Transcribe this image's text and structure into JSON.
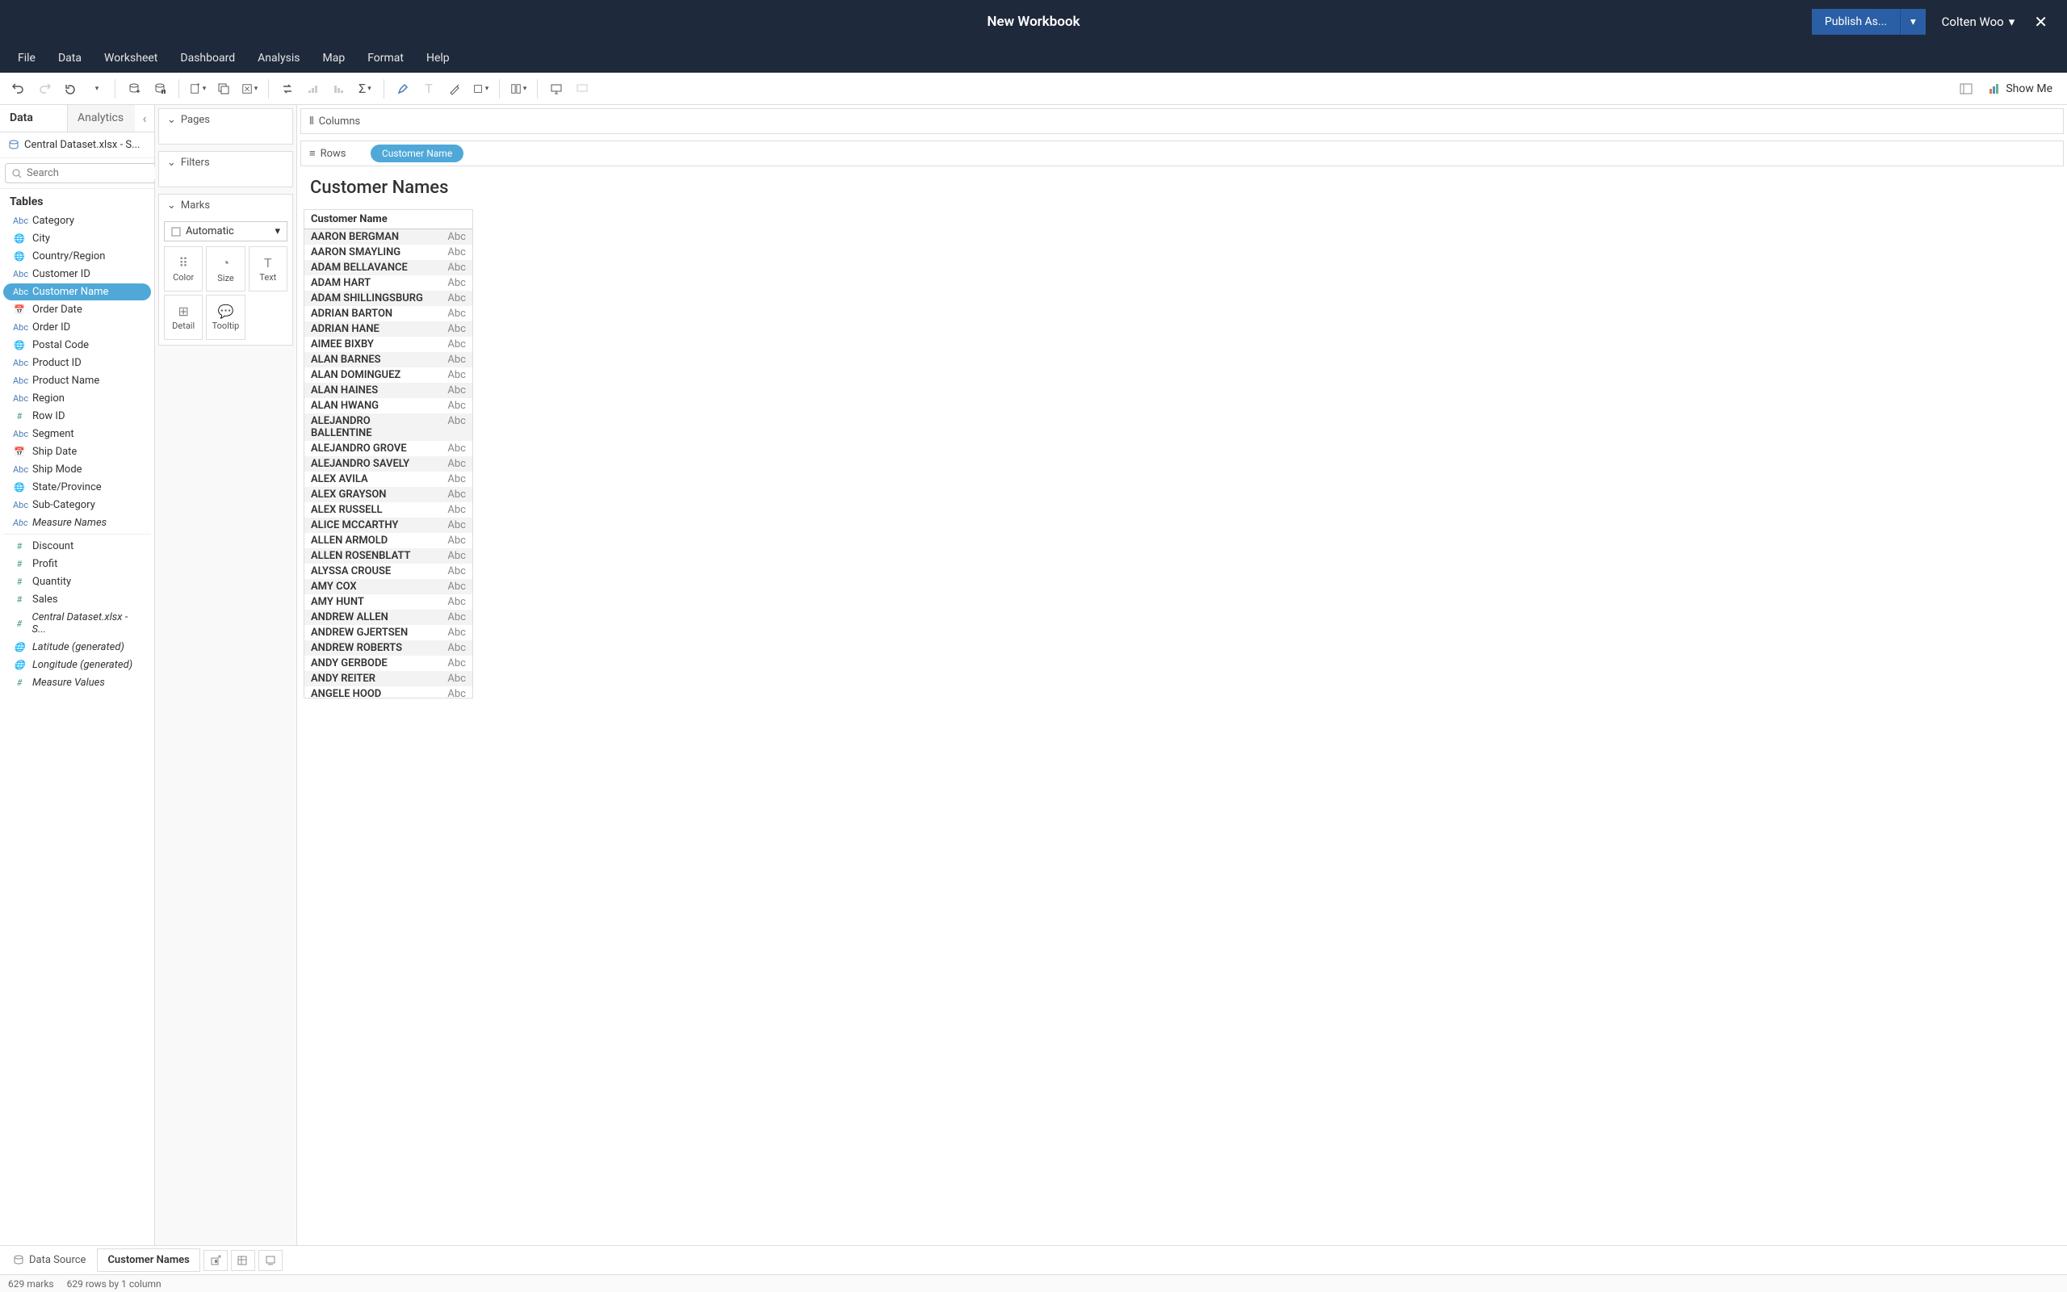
{
  "title": "New Workbook",
  "publish_label": "Publish As...",
  "user_name": "Colten Woo",
  "menus": [
    "File",
    "Data",
    "Worksheet",
    "Dashboard",
    "Analysis",
    "Map",
    "Format",
    "Help"
  ],
  "showme_label": "Show Me",
  "side_tabs": {
    "data": "Data",
    "analytics": "Analytics"
  },
  "datasource": "Central Dataset.xlsx - S...",
  "search_placeholder": "Search",
  "tables_header": "Tables",
  "fields": [
    {
      "icon": "Abc",
      "type": "dim",
      "label": "Category"
    },
    {
      "icon": "globe",
      "type": "dim",
      "label": "City"
    },
    {
      "icon": "globe",
      "type": "dim",
      "label": "Country/Region"
    },
    {
      "icon": "Abc",
      "type": "dim",
      "label": "Customer ID"
    },
    {
      "icon": "Abc",
      "type": "dim",
      "label": "Customer Name",
      "selected": true
    },
    {
      "icon": "cal",
      "type": "dim",
      "label": "Order Date"
    },
    {
      "icon": "Abc",
      "type": "dim",
      "label": "Order ID"
    },
    {
      "icon": "globe",
      "type": "dim",
      "label": "Postal Code"
    },
    {
      "icon": "Abc",
      "type": "dim",
      "label": "Product ID"
    },
    {
      "icon": "Abc",
      "type": "dim",
      "label": "Product Name"
    },
    {
      "icon": "Abc",
      "type": "dim",
      "label": "Region"
    },
    {
      "icon": "#",
      "type": "meas",
      "label": "Row ID"
    },
    {
      "icon": "Abc",
      "type": "dim",
      "label": "Segment"
    },
    {
      "icon": "cal",
      "type": "dim",
      "label": "Ship Date"
    },
    {
      "icon": "Abc",
      "type": "dim",
      "label": "Ship Mode"
    },
    {
      "icon": "globe",
      "type": "dim",
      "label": "State/Province"
    },
    {
      "icon": "Abc",
      "type": "dim",
      "label": "Sub-Category"
    },
    {
      "icon": "Abc",
      "type": "dim",
      "label": "Measure Names",
      "italic": true,
      "sep": true
    },
    {
      "icon": "#",
      "type": "meas",
      "label": "Discount"
    },
    {
      "icon": "#",
      "type": "meas",
      "label": "Profit"
    },
    {
      "icon": "#",
      "type": "meas",
      "label": "Quantity"
    },
    {
      "icon": "#",
      "type": "meas",
      "label": "Sales"
    },
    {
      "icon": "#",
      "type": "meas",
      "label": "Central Dataset.xlsx - S...",
      "italic": true
    },
    {
      "icon": "globe",
      "type": "meas",
      "label": "Latitude (generated)",
      "italic": true
    },
    {
      "icon": "globe",
      "type": "meas",
      "label": "Longitude (generated)",
      "italic": true
    },
    {
      "icon": "#",
      "type": "meas",
      "label": "Measure Values",
      "italic": true
    }
  ],
  "cards": {
    "pages": "Pages",
    "filters": "Filters",
    "marks": "Marks",
    "automatic": "Automatic",
    "mark_cells": [
      {
        "l": "Color"
      },
      {
        "l": "Size"
      },
      {
        "l": "Text"
      },
      {
        "l": "Detail"
      },
      {
        "l": "Tooltip"
      }
    ]
  },
  "shelves": {
    "columns": "Columns",
    "rows": "Rows",
    "pill": "Customer Name"
  },
  "viz": {
    "title": "Customer Names",
    "col_header": "Customer Name",
    "abc": "Abc",
    "rows": [
      "AARON BERGMAN",
      "AARON SMAYLING",
      "ADAM BELLAVANCE",
      "ADAM HART",
      "ADAM SHILLINGSBURG",
      "ADRIAN BARTON",
      "ADRIAN HANE",
      "AIMEE BIXBY",
      "ALAN BARNES",
      "ALAN DOMINGUEZ",
      "ALAN HAINES",
      "ALAN HWANG",
      "ALEJANDRO BALLENTINE",
      "ALEJANDRO GROVE",
      "ALEJANDRO SAVELY",
      "ALEX AVILA",
      "ALEX GRAYSON",
      "ALEX RUSSELL",
      "ALICE MCCARTHY",
      "ALLEN ARMOLD",
      "ALLEN ROSENBLATT",
      "ALYSSA CROUSE",
      "AMY COX",
      "AMY HUNT",
      "ANDREW ALLEN",
      "ANDREW GJERTSEN",
      "ANDREW ROBERTS",
      "ANDY GERBODE",
      "ANDY REITER",
      "ANGELE HOOD"
    ]
  },
  "sheetbar": {
    "data_source": "Data Source",
    "sheet": "Customer Names"
  },
  "status": {
    "marks": "629 marks",
    "dims": "629 rows by 1 column"
  }
}
